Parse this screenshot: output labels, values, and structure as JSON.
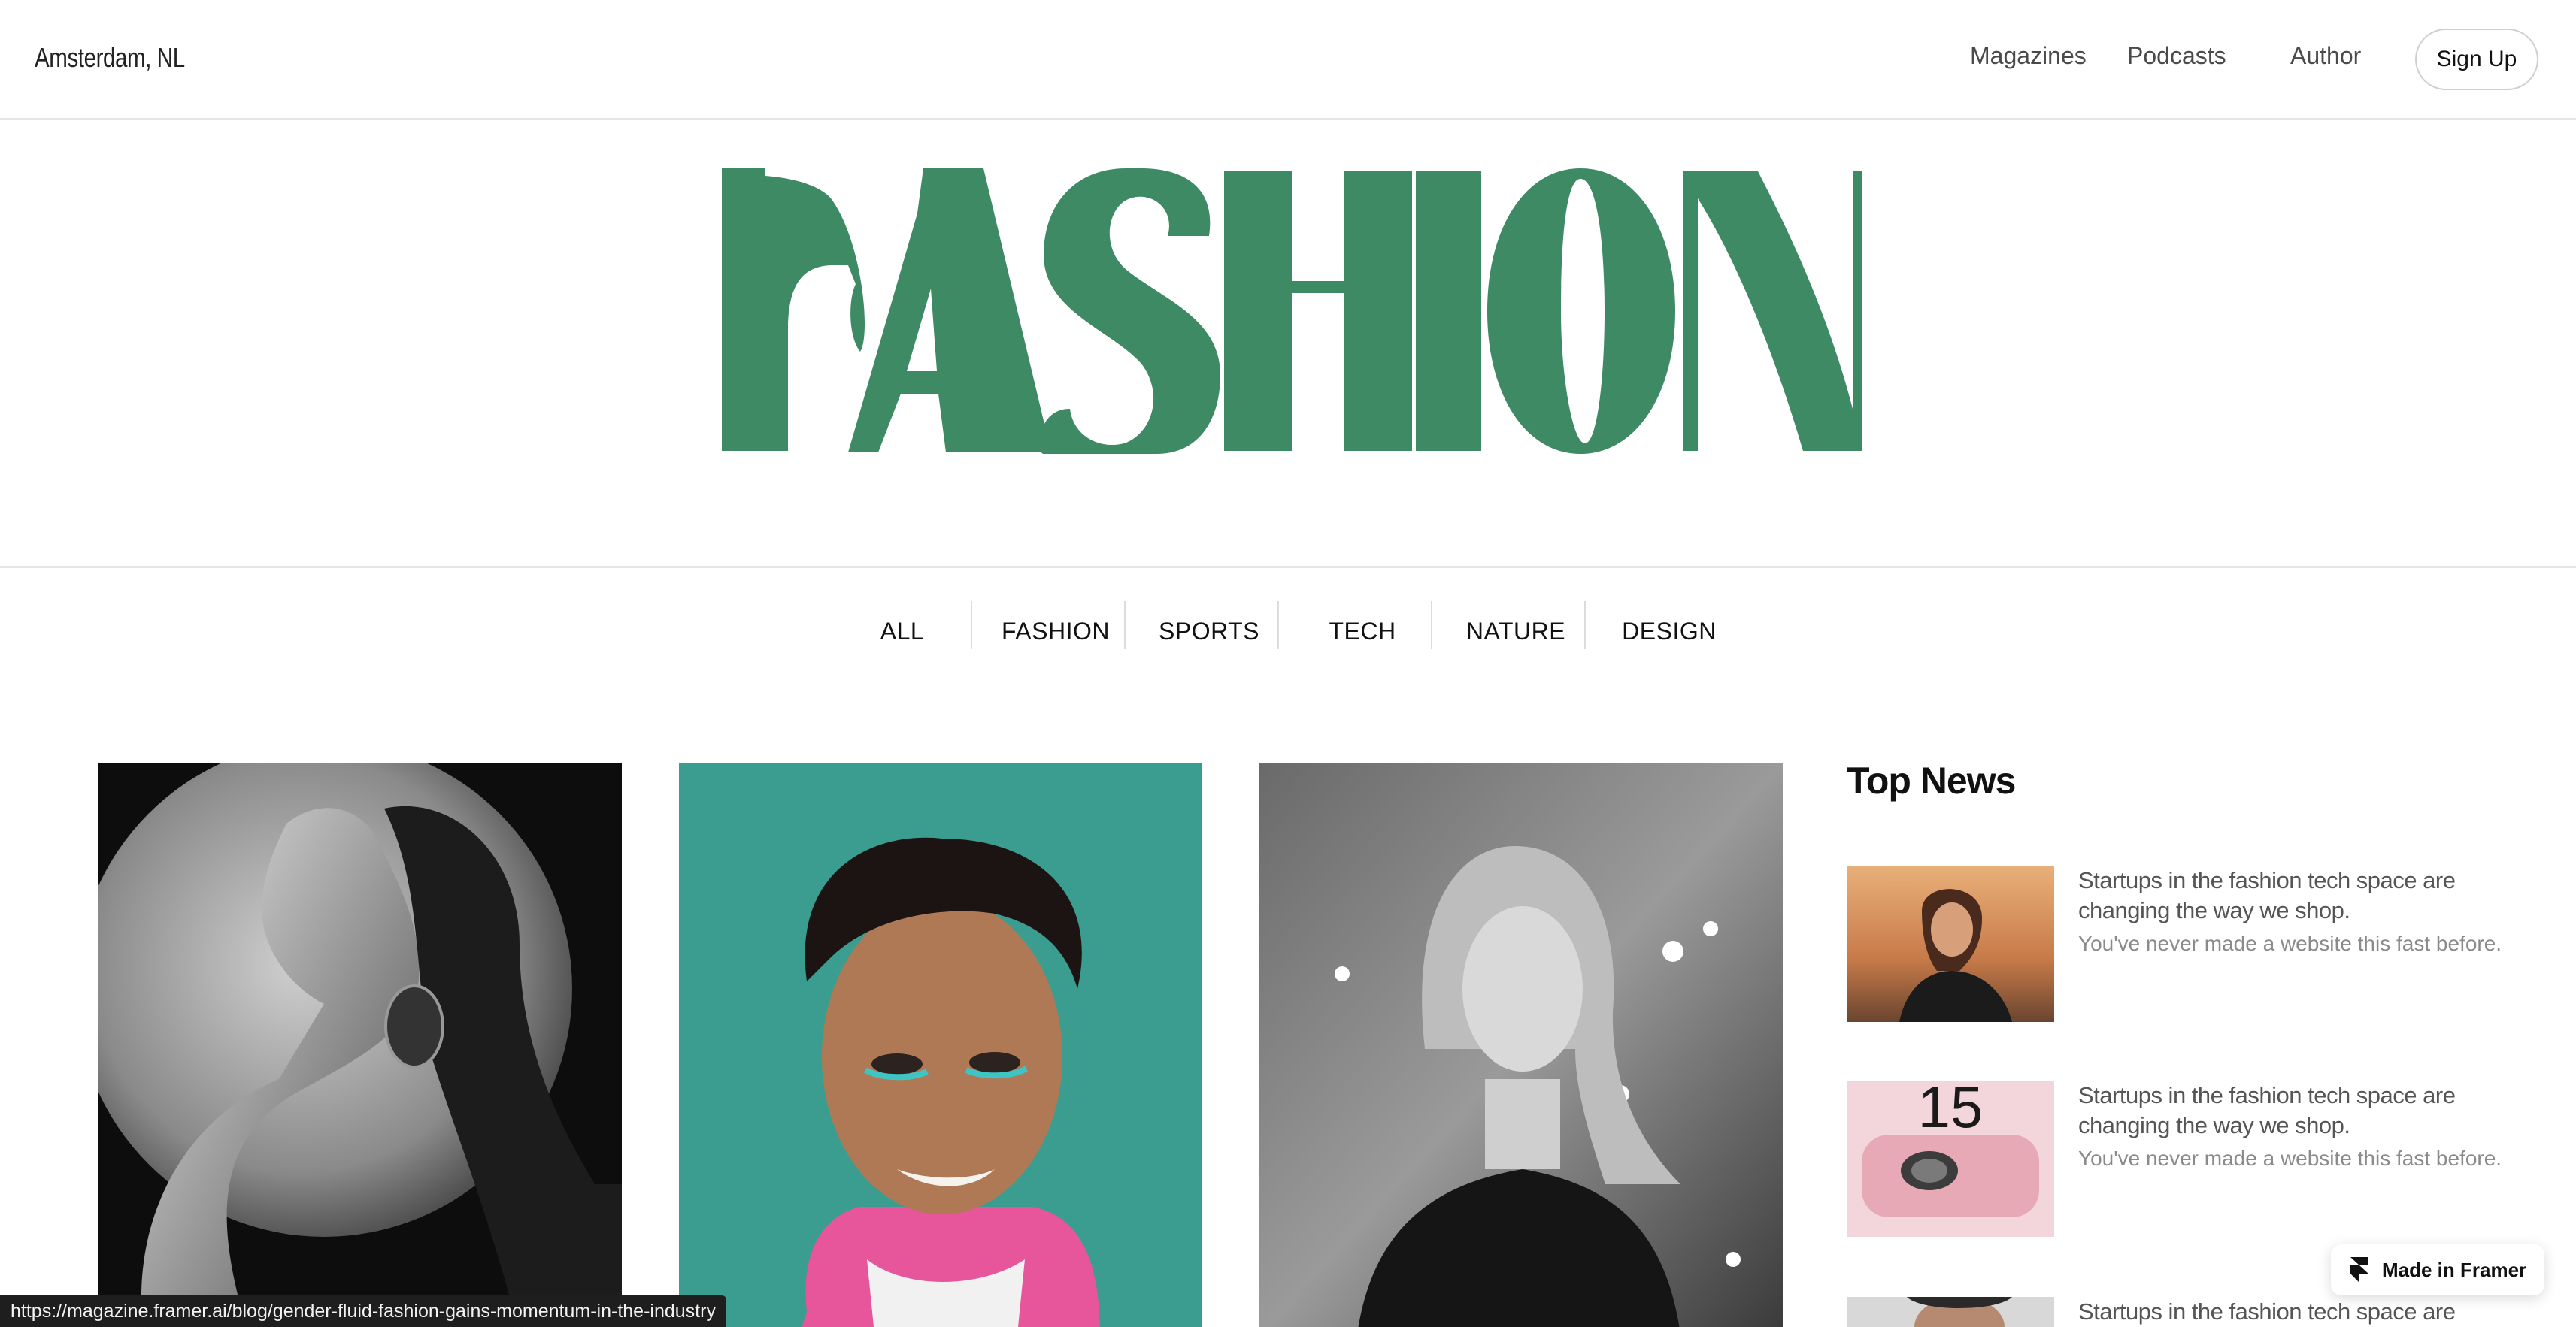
{
  "header": {
    "location": "Amsterdam, NL",
    "nav": [
      "Magazines",
      "Podcasts",
      "Author"
    ],
    "signup_label": "Sign Up"
  },
  "hero": {
    "title": "FASHION",
    "color": "#3e8a64"
  },
  "categories": [
    "ALL",
    "FASHION",
    "SPORTS",
    "TECH",
    "NATURE",
    "DESIGN"
  ],
  "top_news": {
    "heading": "Top News",
    "items": [
      {
        "title": "Startups in the fashion tech space are changing the way we shop.",
        "subtitle": "You've never made a website this fast before."
      },
      {
        "title": "Startups in the fashion tech space are changing the way we shop.",
        "subtitle": "You've never made a website this fast before.",
        "thumb_text": "15"
      },
      {
        "title": "Startups in the fashion tech space are"
      }
    ]
  },
  "badge": {
    "label": "Made in Framer"
  },
  "status_bar": {
    "url": "https://magazine.framer.ai/blog/gender-fluid-fashion-gains-momentum-in-the-industry"
  }
}
